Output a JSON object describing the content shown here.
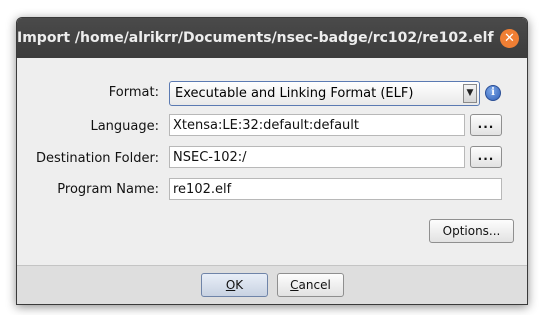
{
  "window": {
    "title": "Import /home/alrikrr/Documents/nsec-badge/rc102/re102.elf",
    "close_glyph": "✕"
  },
  "form": {
    "format": {
      "label": "Format:",
      "value": "Executable and Linking Format (ELF)",
      "arrow_glyph": "▼",
      "info_glyph": "i"
    },
    "language": {
      "label": "Language:",
      "value": "Xtensa:LE:32:default:default",
      "browse_label": "..."
    },
    "destination_folder": {
      "label": "Destination Folder:",
      "value": "NSEC-102:/",
      "browse_label": "..."
    },
    "program_name": {
      "label": "Program Name:",
      "value": "re102.elf"
    },
    "options_label": "Options..."
  },
  "buttons": {
    "ok_mnemonic": "O",
    "ok_rest": "K",
    "cancel_mnemonic": "C",
    "cancel_rest": "ancel"
  },
  "colors": {
    "titlebar": "#3f3f3f",
    "close_button": "#f07f34",
    "info_icon": "#2f5fb8"
  }
}
